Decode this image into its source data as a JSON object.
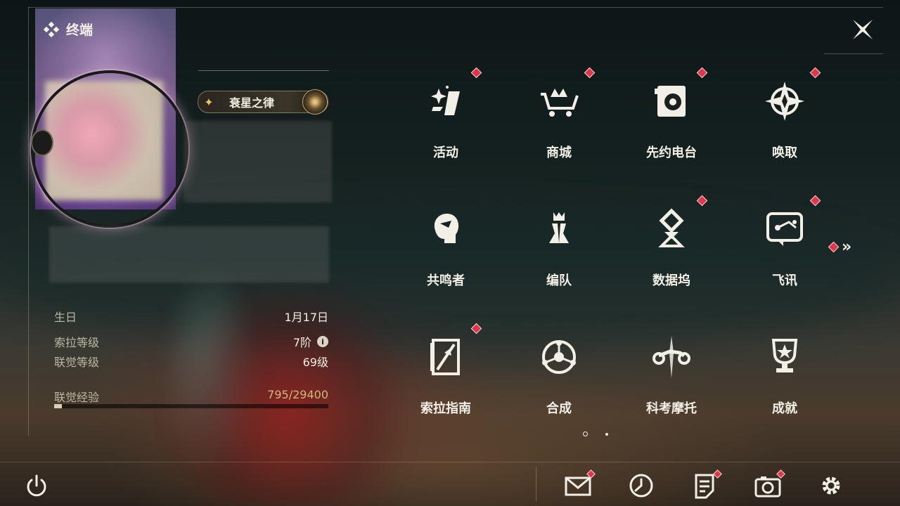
{
  "header": {
    "title": "终端",
    "title_icon": "diamond-cluster-icon",
    "close_icon": "close-x-icon"
  },
  "profile": {
    "title_badge": "衰星之律",
    "stats": [
      {
        "label": "生日",
        "value": "1月17日"
      },
      {
        "label": "索拉等级",
        "value": "7阶",
        "has_info": true
      },
      {
        "label": "联觉等级",
        "value": "69级"
      }
    ],
    "exp": {
      "label": "联觉经验",
      "value": "795/29400",
      "current": 795,
      "max": 29400,
      "fraction": 0.027
    }
  },
  "menu": [
    {
      "label": "活动",
      "icon": "activity-icon",
      "dot": true
    },
    {
      "label": "商城",
      "icon": "shop-cart-icon",
      "dot": true
    },
    {
      "label": "先约电台",
      "icon": "radio-icon",
      "dot": true
    },
    {
      "label": "唤取",
      "icon": "summon-compass-icon",
      "dot": true
    },
    {
      "label": "共鸣者",
      "icon": "resonator-head-icon",
      "dot": false
    },
    {
      "label": "编队",
      "icon": "team-chess-icon",
      "dot": false
    },
    {
      "label": "数据坞",
      "icon": "data-dock-icon",
      "dot": true
    },
    {
      "label": "飞讯",
      "icon": "message-chat-icon",
      "dot": true
    },
    {
      "label": "索拉指南",
      "icon": "guide-book-icon",
      "dot": true
    },
    {
      "label": "合成",
      "icon": "synthesis-icon",
      "dot": false
    },
    {
      "label": "科考摩托",
      "icon": "motorcycle-icon",
      "dot": false
    },
    {
      "label": "成就",
      "icon": "trophy-icon",
      "dot": false
    }
  ],
  "pager": {
    "pages": 2,
    "active": 1
  },
  "bottom": {
    "power": "power-icon",
    "buttons": [
      {
        "icon": "mail-icon",
        "dot": true
      },
      {
        "icon": "clock-icon",
        "dot": false
      },
      {
        "icon": "notes-icon",
        "dot": true
      },
      {
        "icon": "camera-icon",
        "dot": true
      },
      {
        "icon": "settings-gear-icon",
        "dot": false
      }
    ]
  },
  "colors": {
    "accent": "#e0364a",
    "text": "#f2efe6",
    "exp": "#d4b77a"
  }
}
